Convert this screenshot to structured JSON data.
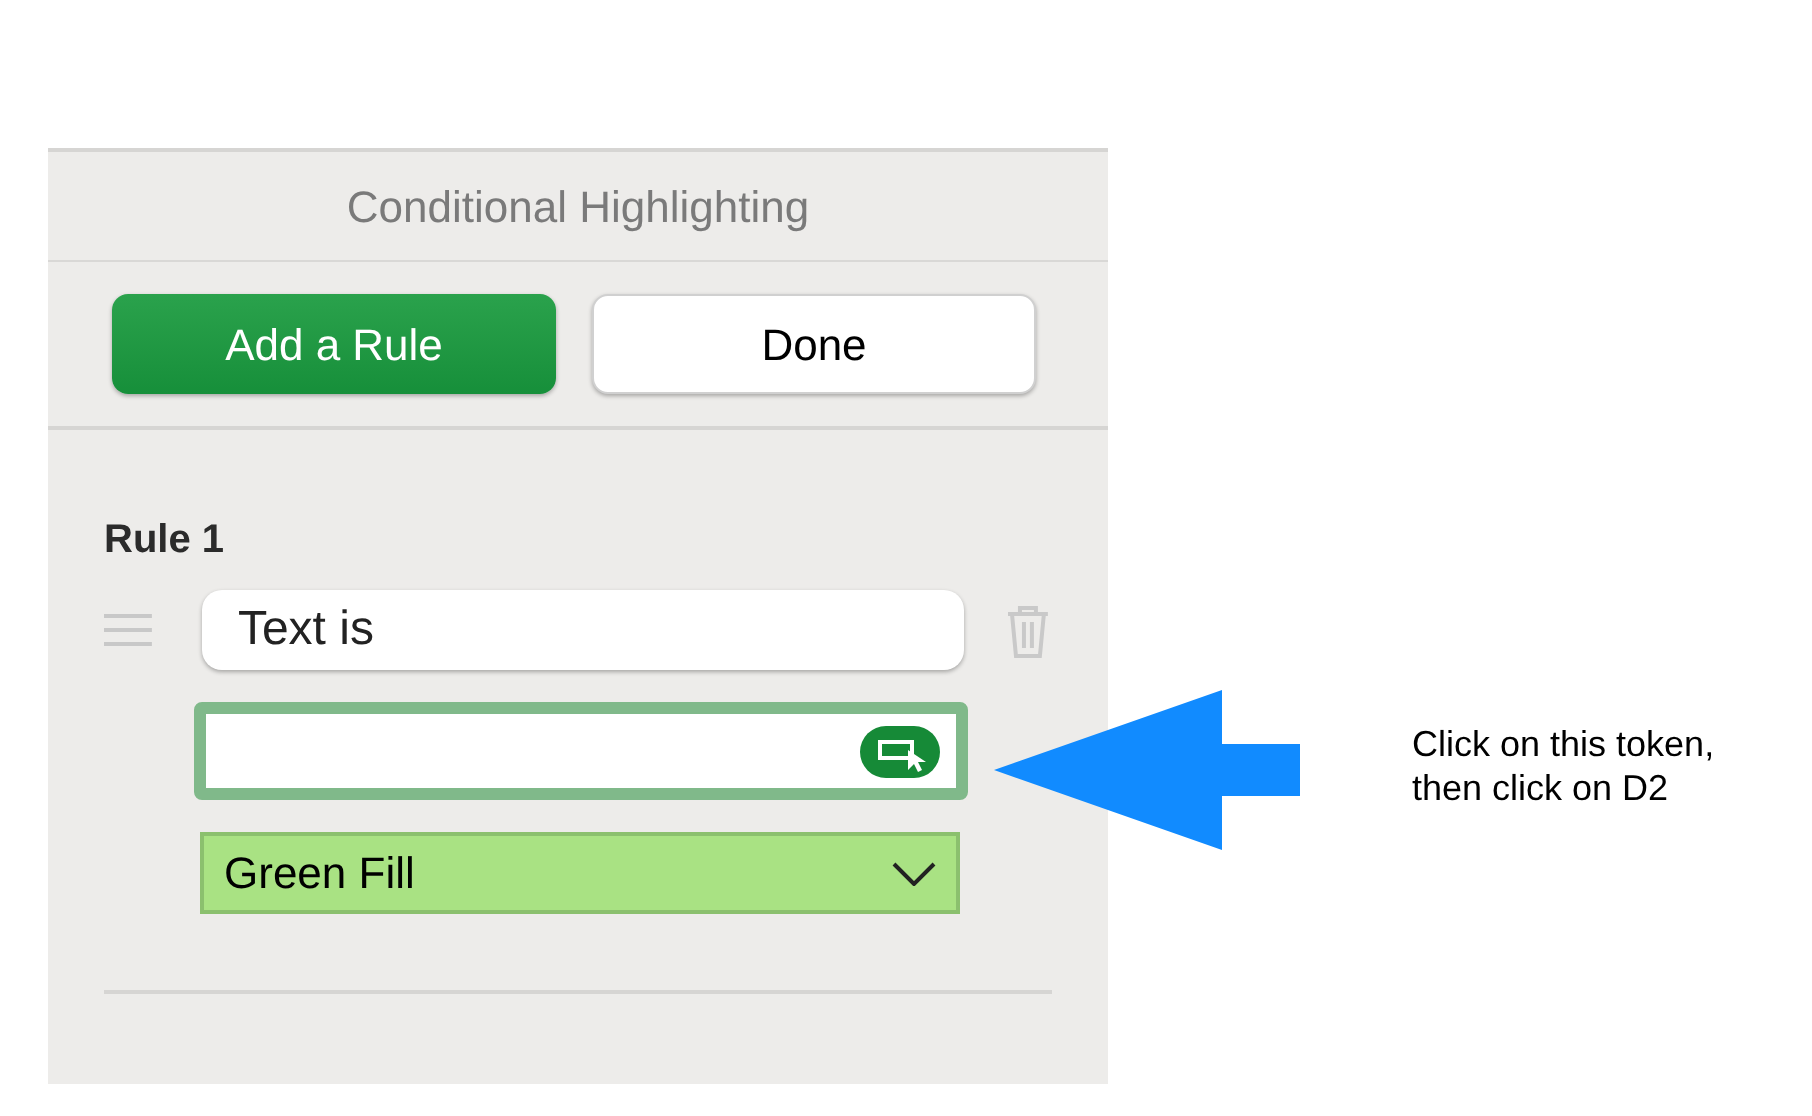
{
  "panel": {
    "title": "Conditional Highlighting",
    "buttons": [
      {
        "label": "Add a Rule",
        "kind": "primary"
      },
      {
        "label": "Done",
        "kind": "secondary"
      }
    ]
  },
  "rules": [
    {
      "title": "Rule 1",
      "condition": "Text is",
      "value_focused": true,
      "style": "Green Fill"
    }
  ],
  "annotation": {
    "text": "Click on this token,\nthen click on D2"
  }
}
